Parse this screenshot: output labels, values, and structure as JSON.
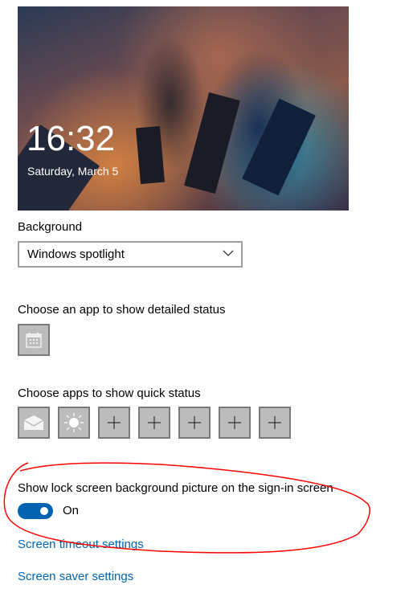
{
  "preview": {
    "time": "16:32",
    "date": "Saturday, March 5"
  },
  "background": {
    "label": "Background",
    "selected": "Windows spotlight"
  },
  "detailed_status": {
    "label": "Choose an app to show detailed status",
    "apps": [
      {
        "icon": "calendar-icon"
      }
    ]
  },
  "quick_status": {
    "label": "Choose apps to show quick status",
    "apps": [
      {
        "icon": "mail-icon"
      },
      {
        "icon": "weather-sun-icon"
      },
      {
        "icon": "plus-icon"
      },
      {
        "icon": "plus-icon"
      },
      {
        "icon": "plus-icon"
      },
      {
        "icon": "plus-icon"
      },
      {
        "icon": "plus-icon"
      }
    ]
  },
  "signin": {
    "label": "Show lock screen background picture on the sign-in screen",
    "toggle_state": "On",
    "enabled": true
  },
  "links": {
    "timeout": "Screen timeout settings",
    "saver": "Screen saver settings"
  },
  "colors": {
    "accent": "#0063b1",
    "annotation": "#ff0000"
  }
}
